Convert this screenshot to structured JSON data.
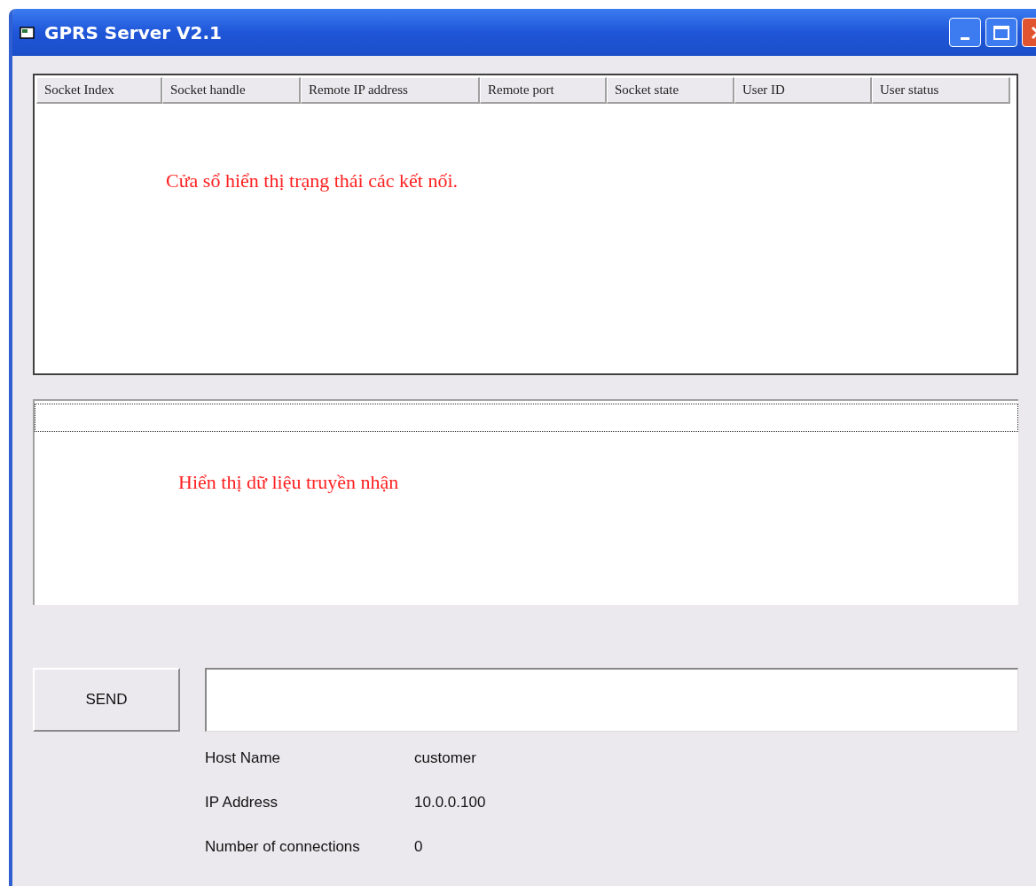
{
  "window": {
    "title": "GPRS Server V2.1"
  },
  "connections_table": {
    "columns": [
      "Socket Index",
      "Socket handle",
      "Remote IP address",
      "Remote port",
      "Socket state",
      "User ID",
      "User status"
    ],
    "note": "Cửa sổ hiển thị trạng thái các kết nối."
  },
  "data_log": {
    "note": "Hiển thị dữ liệu truyền nhận"
  },
  "send_button": {
    "label": "SEND"
  },
  "info": [
    {
      "label": "Host Name",
      "value": "customer"
    },
    {
      "label": "IP Address",
      "value": "10.0.0.100"
    },
    {
      "label": "Number of connections",
      "value": "0"
    }
  ]
}
